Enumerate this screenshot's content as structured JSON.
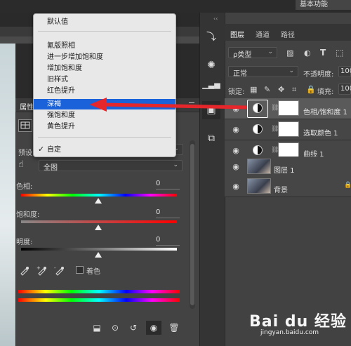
{
  "workspace_button": "基本功能",
  "adjustment_menu": {
    "items": [
      {
        "label": "默认值"
      },
      {
        "label": "氰版照相"
      },
      {
        "label": "进一步增加饱和度"
      },
      {
        "label": "增加饱和度"
      },
      {
        "label": "旧样式"
      },
      {
        "label": "红色提升"
      },
      {
        "label": "深褐",
        "selected": true
      },
      {
        "label": "强饱和度"
      },
      {
        "label": "黄色提升"
      },
      {
        "label": "自定",
        "checked": true
      }
    ],
    "checkmark": "✓"
  },
  "properties_panel": {
    "title": "属性",
    "preset_label": "预设",
    "channel_value": "全图",
    "hue_label": "色相:",
    "hue_value": "0",
    "saturation_label": "饱和度:",
    "saturation_value": "0",
    "lightness_label": "明度:",
    "lightness_value": "0",
    "colorize_label": "着色",
    "colorize_checked": false
  },
  "layers_panel": {
    "tabs": [
      "图层",
      "通道",
      "路径"
    ],
    "active_tab": "图层",
    "filter_kind": "ρ类型",
    "blend_mode": "正常",
    "opacity_label": "不透明度:",
    "opacity_value": "100",
    "lock_label": "锁定:",
    "fill_label": "填充:",
    "fill_value": "100",
    "layers": [
      {
        "name": "色相/饱和度 1",
        "kind": "adjustment",
        "selected": true
      },
      {
        "name": "选取颜色 1",
        "kind": "adjustment",
        "selected": false
      },
      {
        "name": "曲线 1",
        "kind": "adjustment",
        "selected": false
      },
      {
        "name": "图层 1",
        "kind": "pixel",
        "selected": false
      },
      {
        "name": "背景",
        "kind": "pixel",
        "selected": false
      }
    ]
  },
  "watermark": {
    "brand": "Bai du 经验",
    "url": "jingyan.baidu.com"
  },
  "colors": {
    "selection_blue": "#1a62d9",
    "arrow_red": "#e5262b",
    "panel_bg": "#434343"
  }
}
